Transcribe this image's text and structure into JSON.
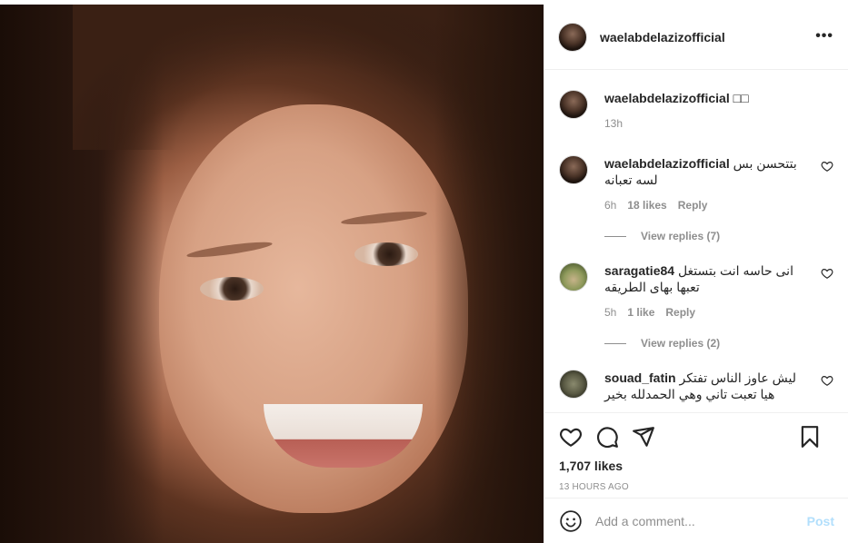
{
  "post": {
    "author": "waelabdelazizofficial",
    "more_icon": "•••"
  },
  "caption": {
    "username": "waelabdelazizofficial",
    "text": "□□",
    "time": "13h"
  },
  "comments": [
    {
      "username": "waelabdelazizofficial",
      "text": "بتتحسن بس لسه تعبانه",
      "time": "6h",
      "likes": "18 likes",
      "reply": "Reply",
      "view_replies": "View replies (7)"
    },
    {
      "username": "saragatie84",
      "text": "انى حاسه انت بتستغل تعبها بهاى الطريقه",
      "time": "5h",
      "likes": "1 like",
      "reply": "Reply",
      "view_replies": "View replies (2)"
    },
    {
      "username": "souad_fatin",
      "text": "ليش عاوز الناس تفتكر هيا تعبت تاني وهي الحمدلله بخير"
    }
  ],
  "stats": {
    "likes": "1,707 likes",
    "time": "13 HOURS AGO"
  },
  "add_comment": {
    "placeholder": "Add a comment...",
    "post_label": "Post"
  },
  "icons": {
    "like": "heart-icon",
    "comment": "comment-icon",
    "share": "share-icon",
    "save": "bookmark-icon",
    "emoji": "emoji-icon"
  }
}
